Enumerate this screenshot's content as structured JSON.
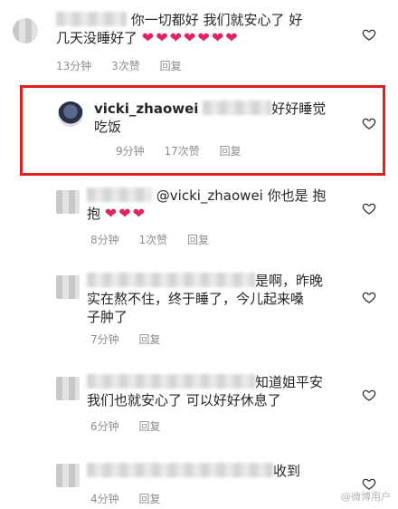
{
  "comments": [
    {
      "text_a": "你一切都好 我们就安心了 好",
      "text_b": "几天没睡好了",
      "hearts": "❤❤❤❤❤❤❤",
      "time": "13分钟",
      "likes": "3次赞",
      "reply": "回复"
    },
    {
      "username": "vicki_zhaowei",
      "text_a": "好好睡觉",
      "text_b": "吃饭",
      "time": "9分钟",
      "likes": "17次赞",
      "reply": "回复"
    },
    {
      "mention": "@vicki_zhaowei",
      "text_a": "你也是 抱",
      "text_b": "抱",
      "hearts": "❤❤❤",
      "time": "8分钟",
      "likes": "1次赞",
      "reply": "回复"
    },
    {
      "text_a": "是啊，昨晚",
      "text_b": "实在熬不住，终于睡了，今儿起来嗓",
      "text_c": "子肿了",
      "time": "7分钟",
      "reply": "回复"
    },
    {
      "text_a": "知道姐平安",
      "text_b": "我们也就安心了 可以好好休息了",
      "time": "6分钟",
      "reply": "回复"
    },
    {
      "text_a": "收到",
      "time": "4分钟",
      "reply": "回复"
    }
  ],
  "watermark": "@微博用户",
  "colors": {
    "highlight": "#e02020",
    "meta": "#8e8e8e",
    "heart": "#e0245e"
  },
  "icons": {
    "like": "heart-outline-icon"
  }
}
